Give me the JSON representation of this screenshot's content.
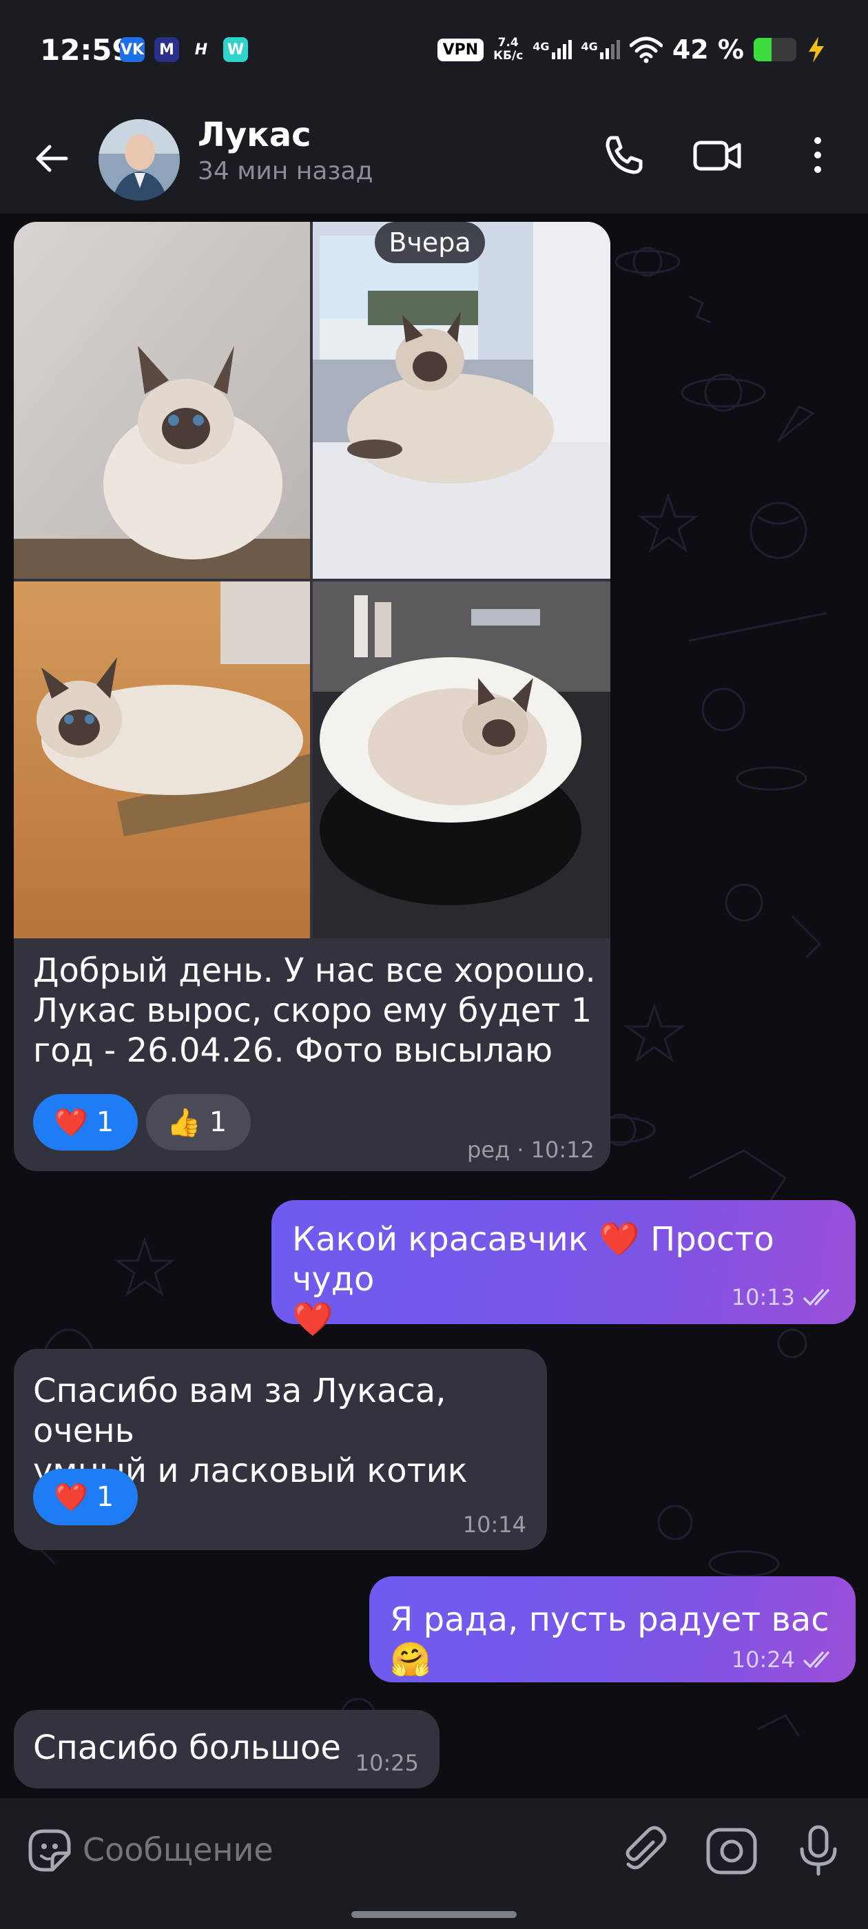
{
  "status_bar": {
    "time": "12:59",
    "apps": [
      "VK",
      "M",
      "H",
      "W"
    ],
    "vpn": "VPN",
    "speed_value": "7.4",
    "speed_unit": "КБ/с",
    "net1": "4G",
    "net2": "4G",
    "battery_percent": "42 %",
    "battery_level": 0.42,
    "icons": [
      "wifi-icon",
      "battery-icon",
      "charging-icon"
    ]
  },
  "header": {
    "contact_name": "Лукас",
    "last_seen": "34 мин назад",
    "icons": [
      "back-arrow-icon",
      "phone-icon",
      "video-call-icon",
      "more-vert-icon"
    ]
  },
  "chat": {
    "date_divider": "Вчера",
    "messages": [
      {
        "direction": "in",
        "photos": [
          "cat-photo-1",
          "cat-photo-2",
          "cat-photo-3",
          "cat-photo-4"
        ],
        "text_lines": [
          "Добрый день. У нас все хорошо.",
          "Лукас вырос, скоро ему будет 1",
          "год - 26.04.26. Фото высылаю"
        ],
        "reactions": [
          {
            "emoji": "❤️",
            "count": "1"
          },
          {
            "emoji": "👍",
            "count": "1"
          }
        ],
        "edited": "ред",
        "time": "10:12"
      },
      {
        "direction": "out",
        "text_lines": [
          "Какой красавчик ❤️ Просто чудо",
          "❤️"
        ],
        "time": "10:13",
        "read": true
      },
      {
        "direction": "in",
        "text_lines": [
          "Спасибо вам за Лукаса, очень",
          "умный и ласковый котик"
        ],
        "reactions": [
          {
            "emoji": "❤️",
            "count": "1"
          }
        ],
        "time": "10:14"
      },
      {
        "direction": "out",
        "text_lines": [
          "Я рада, пусть радует вас🤗"
        ],
        "time": "10:24",
        "read": true
      },
      {
        "direction": "in",
        "text_lines": [
          "Спасибо большое"
        ],
        "time": "10:25"
      }
    ]
  },
  "input": {
    "placeholder": "Сообщение",
    "icons": [
      "sticker-icon",
      "attach-icon",
      "camera-icon",
      "mic-icon"
    ]
  },
  "colors": {
    "bar_bg": "#1b1c21",
    "incoming_bubble": "#32333e",
    "outgoing_gradient_start": "#6e5cf0",
    "outgoing_gradient_end": "#9b4fd8",
    "reaction_blue": "#1e7cf5",
    "battery_green": "#3ddc3d"
  }
}
